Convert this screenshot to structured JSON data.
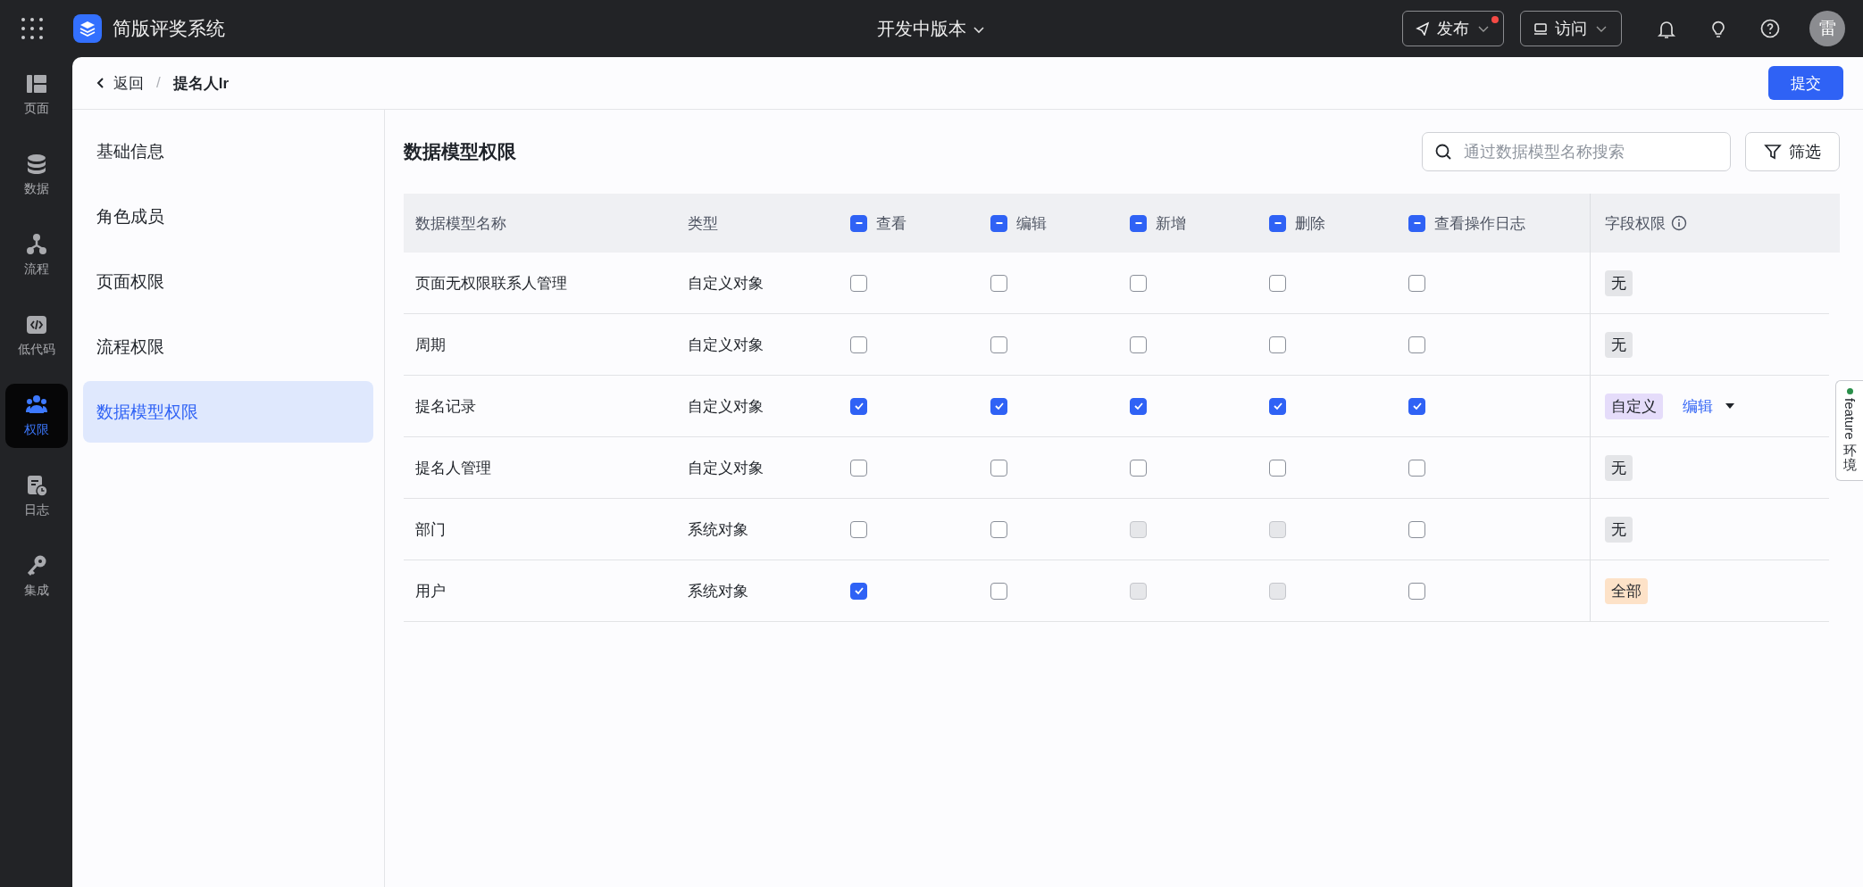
{
  "topbar": {
    "app_name": "简版评奖系统",
    "version": "开发中版本",
    "publish": {
      "label": "发布",
      "badge": true
    },
    "visit": {
      "label": "访问"
    },
    "avatar": "雷"
  },
  "rail": [
    {
      "label": "页面",
      "selected": false
    },
    {
      "label": "数据",
      "selected": false
    },
    {
      "label": "流程",
      "selected": false
    },
    {
      "label": "低代码",
      "selected": false
    },
    {
      "label": "权限",
      "selected": true
    },
    {
      "label": "日志",
      "selected": false
    },
    {
      "label": "集成",
      "selected": false
    }
  ],
  "breadcrumb": {
    "back": "返回",
    "separator": "/",
    "current": "提名人lr"
  },
  "submit": "提交",
  "menu": [
    {
      "label": "基础信息",
      "selected": false
    },
    {
      "label": "角色成员",
      "selected": false
    },
    {
      "label": "页面权限",
      "selected": false
    },
    {
      "label": "流程权限",
      "selected": false
    },
    {
      "label": "数据模型权限",
      "selected": true
    }
  ],
  "section": {
    "title": "数据模型权限",
    "search": {
      "placeholder": "通过数据模型名称搜索"
    },
    "filter": "筛选"
  },
  "table": {
    "columns": [
      {
        "label": "数据模型名称",
        "kind": "text"
      },
      {
        "label": "类型",
        "kind": "text"
      },
      {
        "label": "查看",
        "kind": "check",
        "indeterminate": true
      },
      {
        "label": "编辑",
        "kind": "check",
        "indeterminate": true
      },
      {
        "label": "新增",
        "kind": "check",
        "indeterminate": true
      },
      {
        "label": "删除",
        "kind": "check",
        "indeterminate": true
      },
      {
        "label": "查看操作日志",
        "kind": "check",
        "indeterminate": true
      },
      {
        "label": "字段权限",
        "kind": "perm",
        "info": true
      }
    ],
    "rows": [
      {
        "name": "页面无权限联系人管理",
        "type": "自定义对象",
        "perms": [
          {
            "checked": false,
            "disabled": false
          },
          {
            "checked": false,
            "disabled": false
          },
          {
            "checked": false,
            "disabled": false
          },
          {
            "checked": false,
            "disabled": false
          },
          {
            "checked": false,
            "disabled": false
          }
        ],
        "field": {
          "tag": "无",
          "color": "#e4e5e8"
        }
      },
      {
        "name": "周期",
        "type": "自定义对象",
        "perms": [
          {
            "checked": false,
            "disabled": false
          },
          {
            "checked": false,
            "disabled": false
          },
          {
            "checked": false,
            "disabled": false
          },
          {
            "checked": false,
            "disabled": false
          },
          {
            "checked": false,
            "disabled": false
          }
        ],
        "field": {
          "tag": "无",
          "color": "#e4e5e8"
        }
      },
      {
        "name": "提名记录",
        "type": "自定义对象",
        "perms": [
          {
            "checked": true,
            "disabled": false
          },
          {
            "checked": true,
            "disabled": false
          },
          {
            "checked": true,
            "disabled": false
          },
          {
            "checked": true,
            "disabled": false
          },
          {
            "checked": true,
            "disabled": false
          }
        ],
        "field": {
          "tag": "自定义",
          "color": "#e5dcfa",
          "edit": "编辑"
        }
      },
      {
        "name": "提名人管理",
        "type": "自定义对象",
        "perms": [
          {
            "checked": false,
            "disabled": false
          },
          {
            "checked": false,
            "disabled": false
          },
          {
            "checked": false,
            "disabled": false
          },
          {
            "checked": false,
            "disabled": false
          },
          {
            "checked": false,
            "disabled": false
          }
        ],
        "field": {
          "tag": "无",
          "color": "#e4e5e8"
        }
      },
      {
        "name": "部门",
        "type": "系统对象",
        "perms": [
          {
            "checked": false,
            "disabled": false
          },
          {
            "checked": false,
            "disabled": false
          },
          {
            "checked": false,
            "disabled": true
          },
          {
            "checked": false,
            "disabled": true
          },
          {
            "checked": false,
            "disabled": false
          }
        ],
        "field": {
          "tag": "无",
          "color": "#e4e5e8"
        }
      },
      {
        "name": "用户",
        "type": "系统对象",
        "perms": [
          {
            "checked": true,
            "disabled": false
          },
          {
            "checked": false,
            "disabled": false
          },
          {
            "checked": false,
            "disabled": true
          },
          {
            "checked": false,
            "disabled": true
          },
          {
            "checked": false,
            "disabled": false
          }
        ],
        "field": {
          "tag": "全部",
          "color": "#fde2c8"
        }
      }
    ]
  },
  "env_tab": {
    "name": "feature",
    "suffix": "环境"
  }
}
